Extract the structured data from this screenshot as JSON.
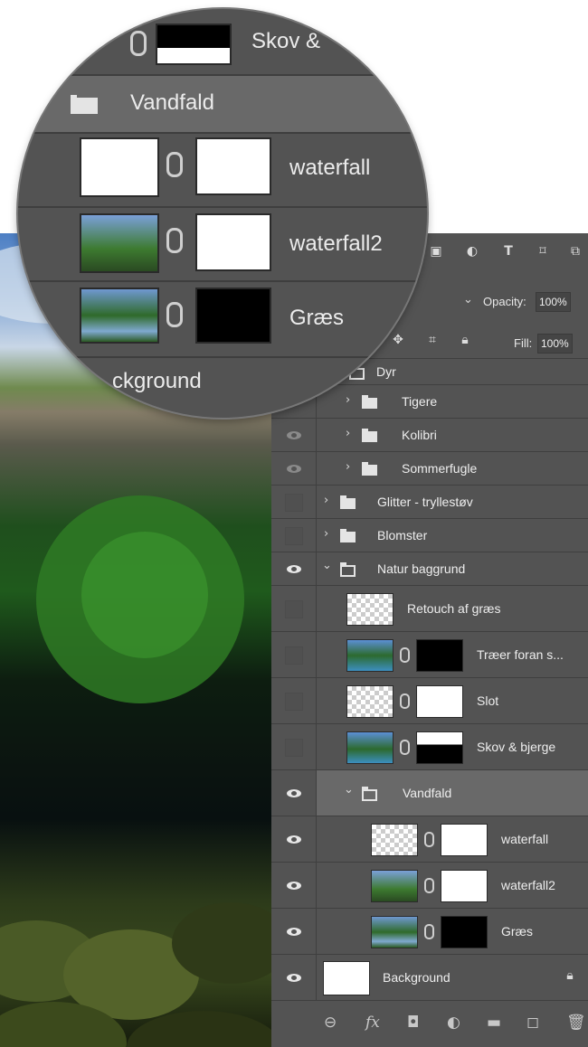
{
  "panel": {
    "opacity_label": "Opacity:",
    "opacity_value": "100%",
    "fill_label": "Fill:",
    "fill_value": "100%",
    "layers": [
      {
        "name": "Dyr"
      },
      {
        "name": "Tigere"
      },
      {
        "name": "Kolibri"
      },
      {
        "name": "Sommerfugle"
      },
      {
        "name": "Glitter - tryllestøv"
      },
      {
        "name": "Blomster"
      },
      {
        "name": "Natur baggrund"
      },
      {
        "name": "Retouch af græs"
      },
      {
        "name": "Træer foran s..."
      },
      {
        "name": "Slot"
      },
      {
        "name": "Skov & bjerge"
      },
      {
        "name": "Vandfald"
      },
      {
        "name": "waterfall"
      },
      {
        "name": "waterfall2"
      },
      {
        "name": "Græs"
      },
      {
        "name": "Background"
      }
    ]
  },
  "magnifier": {
    "top_partial": "Skov &",
    "group": "Vandfald",
    "layer1": "waterfall",
    "layer2": "waterfall2",
    "layer3": "Græs",
    "bottom_partial": "ckground"
  },
  "icons": [
    "eye-icon",
    "folder-icon",
    "chevron-icon",
    "link-icon",
    "lock-icon",
    "move-icon",
    "artboard-icon",
    "image-filter-icon",
    "adjustment-filter-icon",
    "type-filter-icon",
    "shape-filter-icon",
    "smart-object-filter-icon",
    "link-layers-icon",
    "fx-icon",
    "mask-icon",
    "adjustment-icon",
    "new-group-icon",
    "new-layer-icon",
    "trash-icon"
  ]
}
